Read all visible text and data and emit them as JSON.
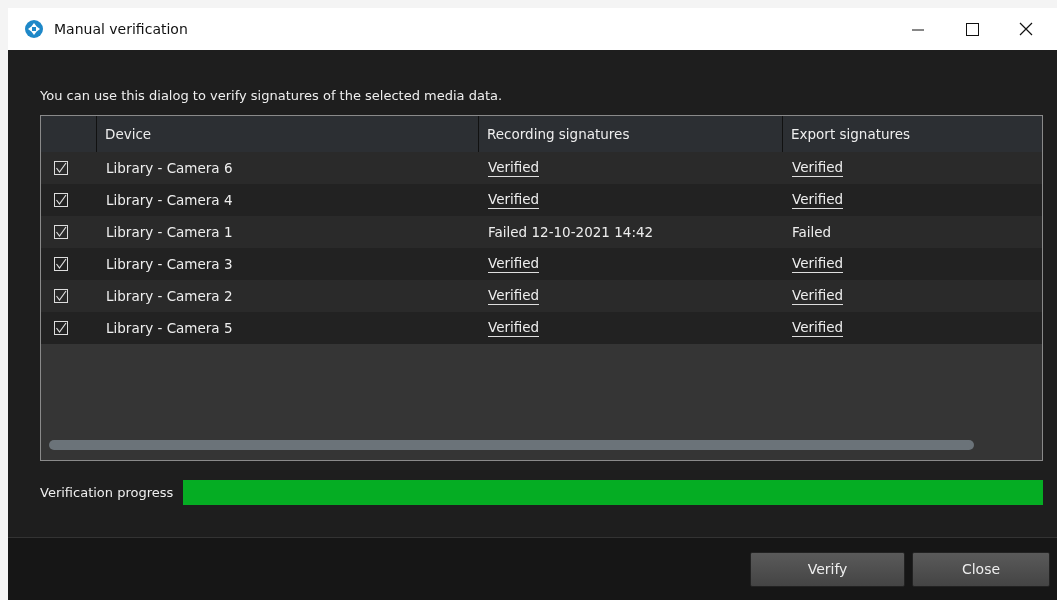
{
  "window": {
    "title": "Manual verification"
  },
  "intro": "You can use this dialog to verify signatures of the selected media data.",
  "table": {
    "columns": [
      "Device",
      "Recording signatures",
      "Export signatures"
    ],
    "rows": [
      {
        "checked": true,
        "device": "Library - Camera 6",
        "recording": {
          "text": "Verified",
          "kind": "link"
        },
        "export": {
          "text": "Verified",
          "kind": "link"
        }
      },
      {
        "checked": true,
        "device": "Library - Camera 4",
        "recording": {
          "text": "Verified",
          "kind": "link"
        },
        "export": {
          "text": "Verified",
          "kind": "link"
        }
      },
      {
        "checked": true,
        "device": "Library - Camera 1",
        "recording": {
          "text": "Failed 12-10-2021 14:42",
          "kind": "text"
        },
        "export": {
          "text": "Failed",
          "kind": "text"
        }
      },
      {
        "checked": true,
        "device": "Library - Camera 3",
        "recording": {
          "text": "Verified",
          "kind": "link"
        },
        "export": {
          "text": "Verified",
          "kind": "link"
        }
      },
      {
        "checked": true,
        "device": "Library - Camera 2",
        "recording": {
          "text": "Verified",
          "kind": "link"
        },
        "export": {
          "text": "Verified",
          "kind": "link"
        }
      },
      {
        "checked": true,
        "device": "Library - Camera 5",
        "recording": {
          "text": "Verified",
          "kind": "link"
        },
        "export": {
          "text": "Verified",
          "kind": "link"
        }
      }
    ]
  },
  "progress": {
    "label": "Verification progress",
    "level": 1
  },
  "buttons": [
    "Verify",
    "Close"
  ]
}
